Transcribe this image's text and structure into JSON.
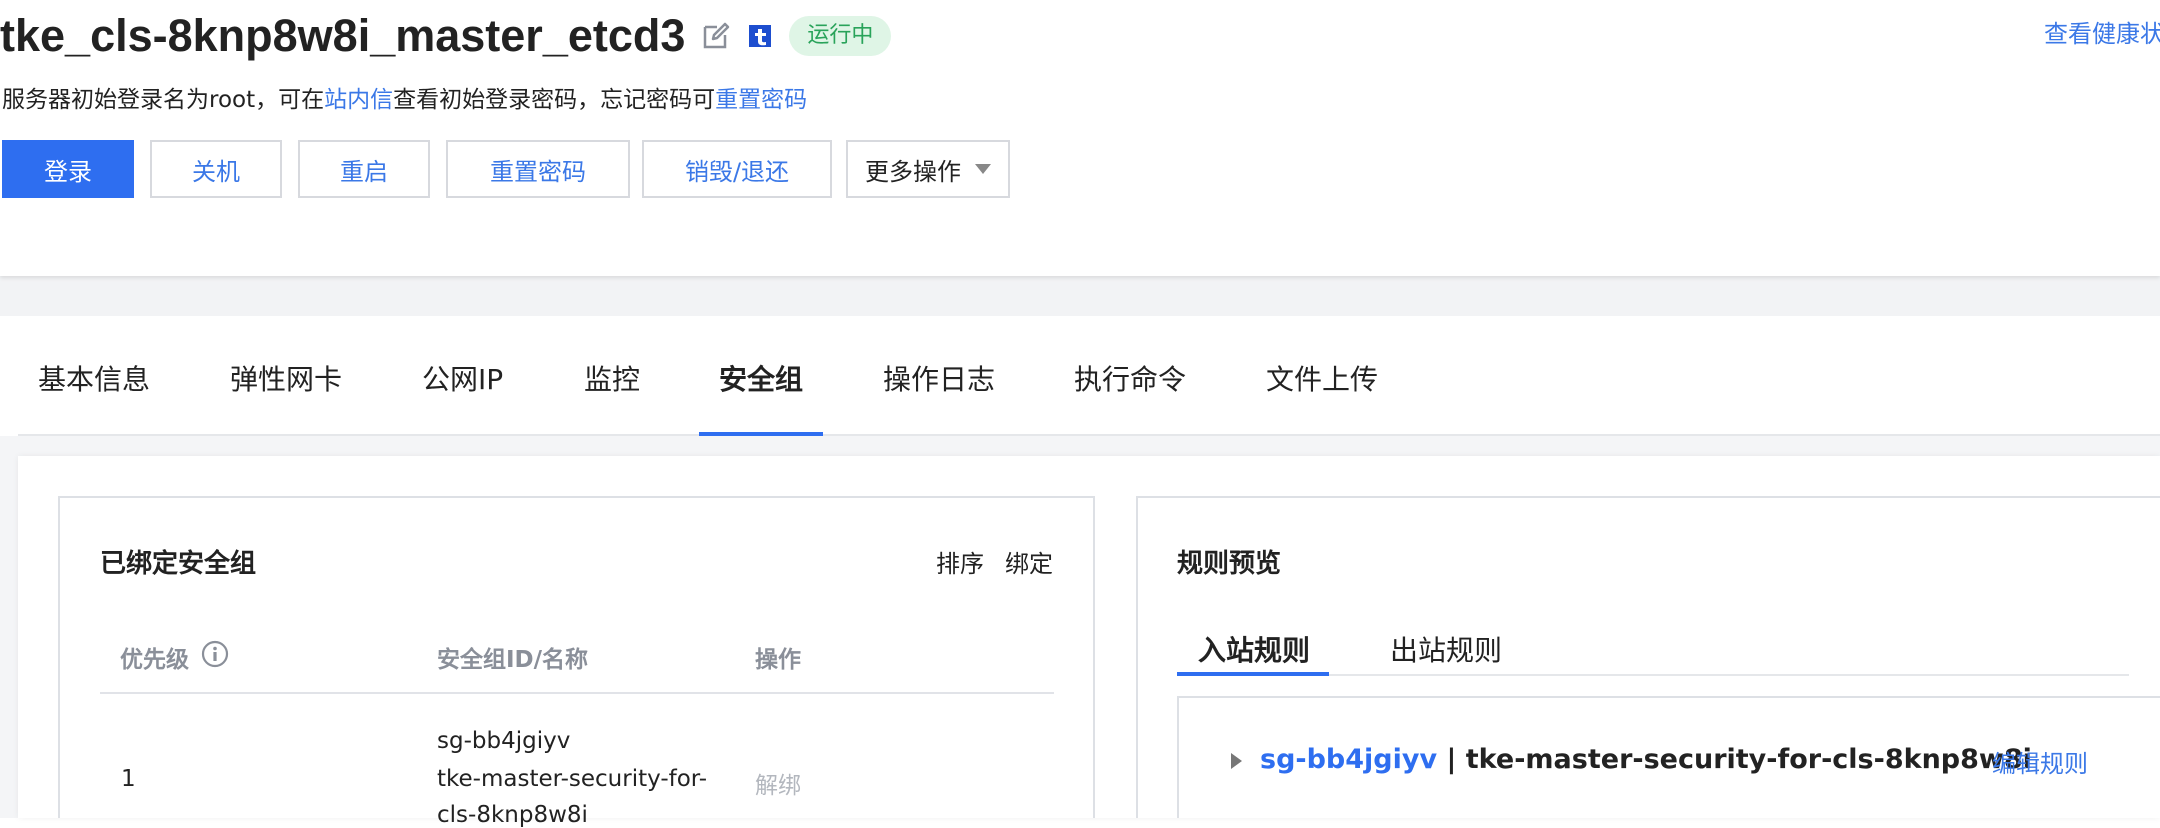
{
  "header": {
    "instance_name": "tke_cls-8knp8w8i_master_etcd3",
    "status": "运行中",
    "health_link": "查看健康状",
    "hint": {
      "part1": "服务器初始登录名为root，可在",
      "link1": "站内信",
      "part2": "查看初始登录密码，忘记密码可",
      "link2": "重置密码"
    },
    "buttons": {
      "login": "登录",
      "shutdown": "关机",
      "restart": "重启",
      "reset_password": "重置密码",
      "destroy": "销毁/退还",
      "more": "更多操作"
    }
  },
  "tabs": [
    "基本信息",
    "弹性网卡",
    "公网IP",
    "监控",
    "安全组",
    "操作日志",
    "执行命令",
    "文件上传"
  ],
  "active_tab": "安全组",
  "bound_groups": {
    "title": "已绑定安全组",
    "actions": {
      "sort": "排序",
      "bind": "绑定"
    },
    "columns": {
      "priority": "优先级",
      "id_name": "安全组ID/名称",
      "operation": "操作"
    },
    "rows": [
      {
        "priority": "1",
        "id": "sg-bb4jgiyv",
        "name_line1": "tke-master-security-for-",
        "name_line2": "cls-8knp8w8i",
        "operation": "解绑"
      }
    ]
  },
  "rules_preview": {
    "title": "规则预览",
    "tabs": {
      "inbound": "入站规则",
      "outbound": "出站规则"
    },
    "rule_group": {
      "id": "sg-bb4jgiyv",
      "separator": " | ",
      "name": "tke-master-security-for-cls-8knp8w8i",
      "edit": "编辑规则"
    }
  },
  "colors": {
    "accent": "#2e6ef0",
    "link": "#3b78e7",
    "status_bg": "#dff5e6",
    "status_text": "#29a35a"
  },
  "icons": [
    "edit-icon",
    "tencent-t-icon",
    "chevron-down-icon",
    "info-icon",
    "caret-right-icon"
  ]
}
